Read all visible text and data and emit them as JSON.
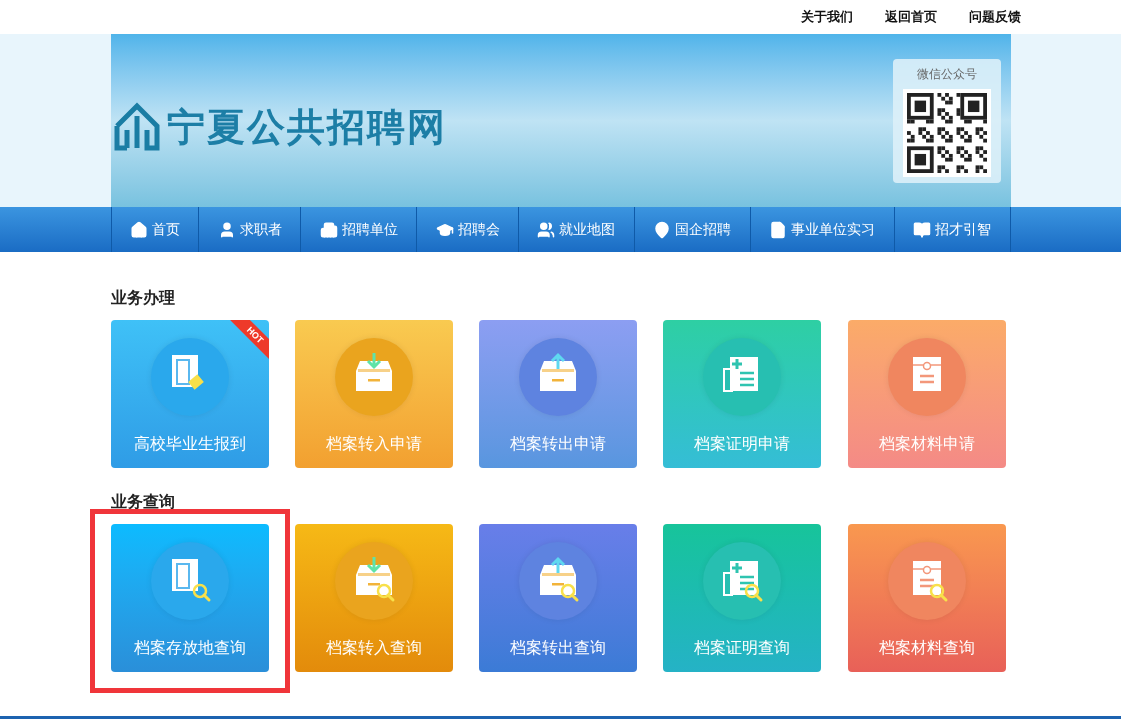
{
  "top_links": [
    "关于我们",
    "返回首页",
    "问题反馈"
  ],
  "banner": {
    "site_title": "宁夏公共招聘网",
    "qr_caption": "微信公众号"
  },
  "nav": [
    {
      "label": "首页"
    },
    {
      "label": "求职者"
    },
    {
      "label": "招聘单位"
    },
    {
      "label": "招聘会"
    },
    {
      "label": "就业地图"
    },
    {
      "label": "国企招聘"
    },
    {
      "label": "事业单位实习"
    },
    {
      "label": "招才引智"
    }
  ],
  "sections": [
    {
      "title": "业务办理",
      "tiles": [
        {
          "label": "高校毕业生报到",
          "kind": "card",
          "search": false,
          "badge": "HOT",
          "highlighted": false
        },
        {
          "label": "档案转入申请",
          "kind": "inbox-in",
          "search": false,
          "highlighted": false
        },
        {
          "label": "档案转出申请",
          "kind": "inbox-out",
          "search": false,
          "highlighted": false
        },
        {
          "label": "档案证明申请",
          "kind": "certificate",
          "search": false,
          "highlighted": false
        },
        {
          "label": "档案材料申请",
          "kind": "envelope",
          "search": false,
          "highlighted": false
        }
      ]
    },
    {
      "title": "业务查询",
      "tiles": [
        {
          "label": "档案存放地查询",
          "kind": "card",
          "search": true,
          "highlighted": true
        },
        {
          "label": "档案转入查询",
          "kind": "inbox-in",
          "search": true,
          "highlighted": false
        },
        {
          "label": "档案转出查询",
          "kind": "inbox-out",
          "search": true,
          "highlighted": false
        },
        {
          "label": "档案证明查询",
          "kind": "certificate",
          "search": true,
          "highlighted": false
        },
        {
          "label": "档案材料查询",
          "kind": "envelope",
          "search": true,
          "highlighted": false
        }
      ]
    }
  ]
}
